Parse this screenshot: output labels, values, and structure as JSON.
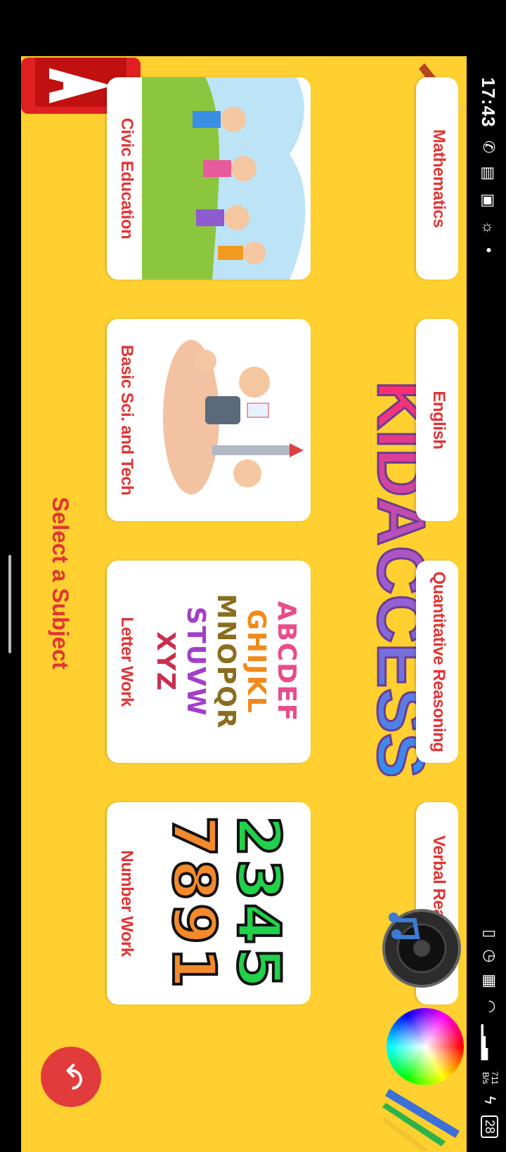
{
  "status_bar": {
    "time": "17:43",
    "network_speed_value": "711",
    "network_speed_unit": "B/s",
    "battery": "28"
  },
  "app": {
    "title": "KIDACCESS",
    "select_prompt": "Select a Subject",
    "back_icon": "back-arrow-icon",
    "music_icon": "speaker-music-icon",
    "color_icon": "color-wheel-icon"
  },
  "subjects_top": [
    {
      "label": "Mathematics"
    },
    {
      "label": "English"
    },
    {
      "label": "Quantitative Reasoning"
    },
    {
      "label": "Verbal Reasoning"
    }
  ],
  "subjects_bottom": [
    {
      "label": "Civic Education"
    },
    {
      "label": "Basic Sci. and Tech"
    },
    {
      "label": "Letter Work"
    },
    {
      "label": "Number Work"
    }
  ],
  "letter_art": {
    "rows": [
      "ABCDEF",
      "GHIJKL",
      "MNOPQR",
      "STUVW",
      "XYZ"
    ]
  },
  "number_art": {
    "top": "2345",
    "bottom": "7891"
  },
  "colors": {
    "background": "#ffd02f",
    "label_red": "#e03535",
    "back_button": "#e23b3b"
  }
}
